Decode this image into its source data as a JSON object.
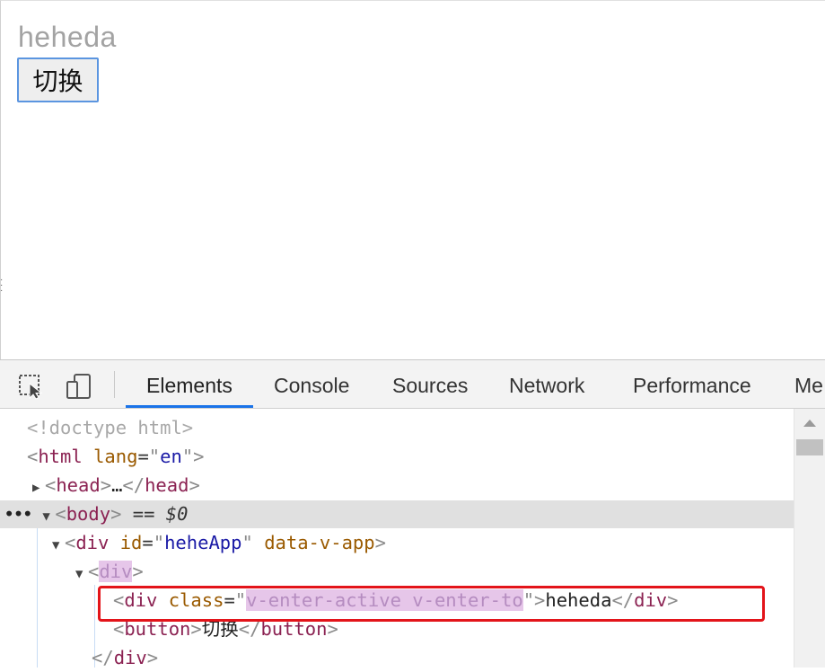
{
  "page": {
    "text": "heheda",
    "button_label": "切换"
  },
  "devtools": {
    "tabs": [
      "Elements",
      "Console",
      "Sources",
      "Network",
      "Performance",
      "Me"
    ],
    "active_tab": "Elements",
    "icons": [
      "inspect-element-icon",
      "device-toolbar-icon"
    ],
    "dom": {
      "doctype": "<!doctype html>",
      "html_tag": "html",
      "html_attr": "lang",
      "html_lang": "en",
      "head_tag": "head",
      "ellipsis": "…",
      "body_tag": "body",
      "selected_marker": "== $0",
      "div_tag": "div",
      "id_attr": "id",
      "app_id": "heheApp",
      "app_attr": "data-v-app",
      "class_attr": "class",
      "inner_class": "v-enter-active v-enter-to",
      "inner_text": "heheda",
      "button_tag": "button",
      "button_text": "切换"
    }
  },
  "colors": {
    "highlight_box": "#e3141a",
    "active_tab_underline": "#1a73e8",
    "class_highlight": "#e6c6e9"
  }
}
